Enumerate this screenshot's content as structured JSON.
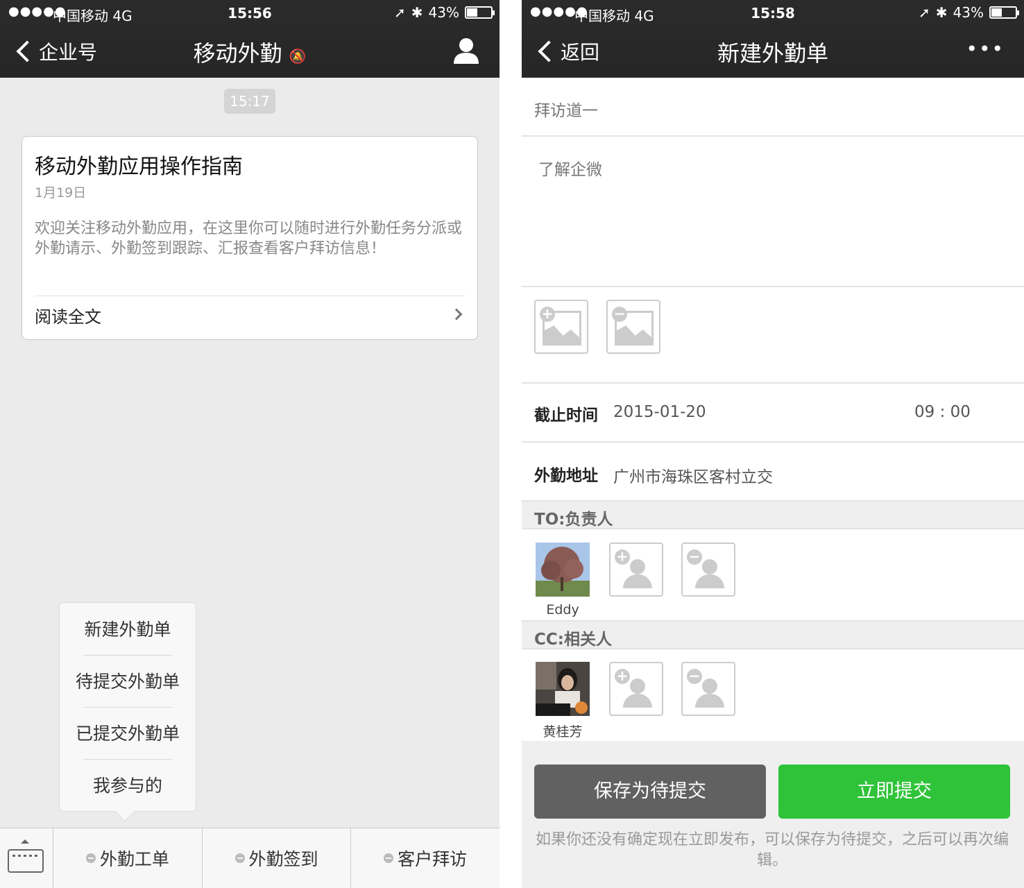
{
  "left": {
    "status": {
      "signal": "●●●●●",
      "carrier": "中国移动",
      "network": "4G",
      "time": "15:56",
      "battery": "43%"
    },
    "nav": {
      "back_label": "企业号",
      "title": "移动外勤"
    },
    "timestamp": "15:17",
    "card": {
      "title": "移动外勤应用操作指南",
      "date": "1月19日",
      "body": "欢迎关注移动外勤应用，在这里你可以随时进行外勤任务分派或外勤请示、外勤签到跟踪、汇报查看客户拜访信息！",
      "read_more": "阅读全文"
    },
    "menu": [
      "新建外勤单",
      "待提交外勤单",
      "已提交外勤单",
      "我参与的"
    ],
    "tabs": [
      "外勤工单",
      "外勤签到",
      "客户拜访"
    ]
  },
  "right": {
    "status": {
      "signal": "●●●●●",
      "carrier": "中国移动",
      "network": "4G",
      "time": "15:58",
      "battery": "43%"
    },
    "nav": {
      "back_label": "返回",
      "title": "新建外勤单",
      "more": "•••"
    },
    "form": {
      "subject": "拜访道一",
      "content": "了解企微",
      "deadline_label": "截止时间",
      "deadline_date": "2015-01-20",
      "deadline_time": "09 : 00",
      "address_label": "外勤地址",
      "address_value": "广州市海珠区客村立交"
    },
    "to_section": {
      "label": "TO:负责人",
      "person": "Eddy"
    },
    "cc_section": {
      "label": "CC:相关人",
      "person": "黄桂芳"
    },
    "buttons": {
      "save": "保存为待提交",
      "submit": "立即提交"
    },
    "hint": "如果你还没有确定现在立即发布，可以保存为待提交，之后可以再次编辑。",
    "colors": {
      "submit": "#2fc339",
      "save": "#616161"
    }
  }
}
